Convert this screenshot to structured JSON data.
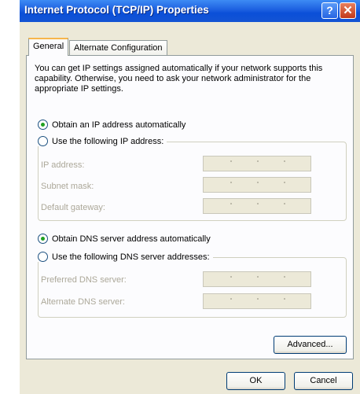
{
  "window": {
    "title": "Internet Protocol (TCP/IP) Properties",
    "help_symbol": "?",
    "close_symbol": "✕"
  },
  "tabs": [
    {
      "label": "General"
    },
    {
      "label": "Alternate Configuration"
    }
  ],
  "intro": "You can get IP settings assigned automatically if your network supports this capability. Otherwise, you need to ask your network administrator for the appropriate IP settings.",
  "ip": {
    "auto_label": "Obtain an IP address automatically",
    "manual_label": "Use the following IP address:",
    "fields": [
      {
        "label": "IP address:"
      },
      {
        "label": "Subnet mask:"
      },
      {
        "label": "Default gateway:"
      }
    ],
    "selected": "auto"
  },
  "dns": {
    "auto_label": "Obtain DNS server address automatically",
    "manual_label": "Use the following DNS server addresses:",
    "fields": [
      {
        "label": "Preferred DNS server:"
      },
      {
        "label": "Alternate DNS server:"
      }
    ],
    "selected": "auto"
  },
  "buttons": {
    "advanced": "Advanced...",
    "ok": "OK",
    "cancel": "Cancel"
  },
  "colors": {
    "titlebar": "#0a4fd8",
    "dialog_bg": "#ece9d8",
    "panel_bg": "#fcfcfe",
    "radio_dot": "#21a121",
    "tab_highlight": "#f7b64c"
  }
}
